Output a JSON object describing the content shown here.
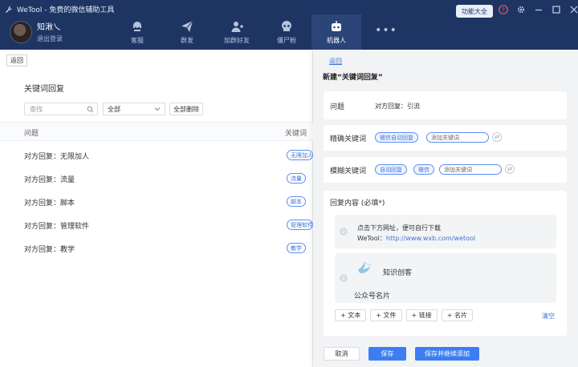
{
  "app": {
    "title": "WeTool - 免费的微信辅助工具",
    "func_btn": "功能大全",
    "user": {
      "name": "知湫乀",
      "logout": "退出登录"
    }
  },
  "nav": [
    {
      "label": "客服",
      "icon": "headset-icon"
    },
    {
      "label": "群发",
      "icon": "send-icon"
    },
    {
      "label": "加群好友",
      "icon": "add-friend-icon"
    },
    {
      "label": "僵尸粉",
      "icon": "skull-icon"
    },
    {
      "label": "机器人",
      "icon": "robot-icon"
    },
    {
      "label": "",
      "icon": "more-icon"
    }
  ],
  "left": {
    "back": "返回",
    "section_title": "关键词回复",
    "search_placeholder": "查找",
    "filter_value": "全部",
    "delete_all": "全部删除",
    "columns": [
      "问题",
      "关键词"
    ],
    "rows": [
      {
        "question": "对方回复：无限加人",
        "keyword": "无限加人"
      },
      {
        "question": "对方回复：流量",
        "keyword": "流量"
      },
      {
        "question": "对方回复：脚本",
        "keyword": "脚本"
      },
      {
        "question": "对方回复：管理软件",
        "keyword": "管理软件"
      },
      {
        "question": "对方回复：教学",
        "keyword": "教学"
      }
    ]
  },
  "right": {
    "back": "返回",
    "title": "新建“关键词回复”",
    "question_label": "问题",
    "question_value": "对方回复：引流",
    "exact_label": "精确关键词",
    "exact_tags": [
      "微信自动回复"
    ],
    "add_keyword": "添加关键词",
    "fuzzy_label": "模糊关键词",
    "fuzzy_tags": [
      "自动回复",
      "微信"
    ],
    "reply_label": "回复内容 (必填*)",
    "reply1_num": "1",
    "reply1_line1": "点击下方网址，便可自行下载",
    "reply1_prefix": "WeTool：",
    "reply1_link": "http://www.wxb.com/wetool",
    "reply2_num": "2",
    "card_name": "知识创客",
    "card_type": "公众号名片",
    "add_buttons": [
      "+ 文本",
      "+ 文件",
      "+ 链接",
      "+ 名片"
    ],
    "clear": "清空",
    "cancel": "取消",
    "save": "保存",
    "save_continue": "保存并继续添加"
  },
  "colors": {
    "header": "#1e3564",
    "accent": "#3c7ef2",
    "tag": "#5b8def"
  }
}
